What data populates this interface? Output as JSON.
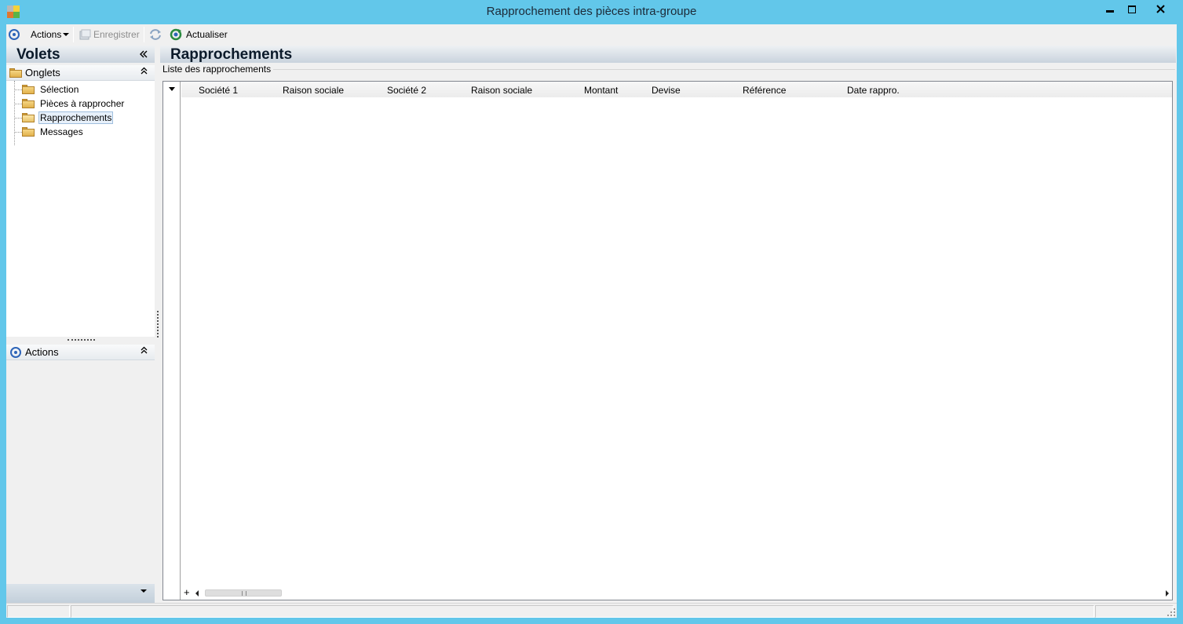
{
  "window": {
    "title": "Rapprochement des pièces intra-groupe",
    "accent": "#62c7ea"
  },
  "toolbar": {
    "actions_label": "Actions",
    "save_label": "Enregistrer",
    "refresh_label": "Actualiser"
  },
  "left_pane": {
    "title": "Volets",
    "onglets_label": "Onglets",
    "items": [
      {
        "label": "Sélection"
      },
      {
        "label": "Pièces à rapprocher"
      },
      {
        "label": "Rapprochements"
      },
      {
        "label": "Messages"
      }
    ],
    "actions_label": "Actions"
  },
  "main": {
    "title": "Rapprochements",
    "group_caption": "Liste des rapprochements",
    "columns": [
      "Société 1",
      "Raison sociale",
      "Société 2",
      "Raison sociale",
      "Montant",
      "Devise",
      "Référence",
      "Date rappro."
    ],
    "add_symbol": "+"
  }
}
